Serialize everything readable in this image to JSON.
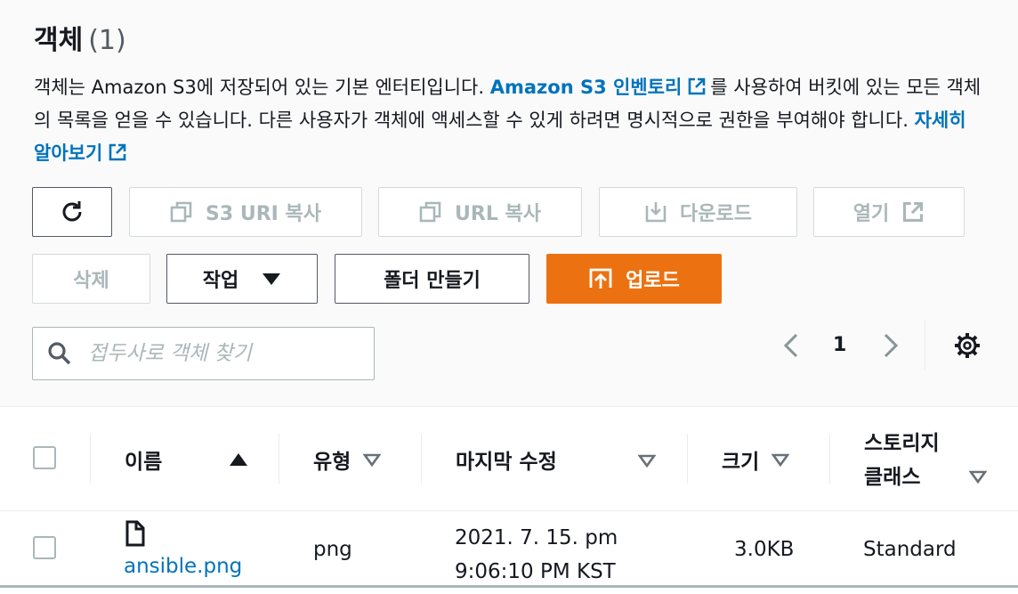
{
  "header": {
    "title": "객체",
    "count": "(1)"
  },
  "description": {
    "part1": "객체는 Amazon S3에 저장되어 있는 기본 엔터티입니다.",
    "link1": "Amazon S3 인벤토리",
    "part2": "를 사용하여 버킷에 있는 모든 객체의 목록을 얻을 수 있습니다. 다른 사용자가 객체에 액세스할 수 있게 하려면 명시적으로 권한을 부여해야 합니다.",
    "link2": "자세히 알아보기"
  },
  "toolbar": {
    "copy_uri": "S3 URI 복사",
    "copy_url": "URL 복사",
    "download": "다운로드",
    "open": "열기",
    "delete": "삭제",
    "actions": "작업",
    "create_folder": "폴더 만들기",
    "upload": "업로드"
  },
  "search": {
    "placeholder": "접두사로 객체 찾기"
  },
  "pagination": {
    "page": "1"
  },
  "table": {
    "columns": {
      "name": "이름",
      "type": "유형",
      "modified": "마지막 수정",
      "size": "크기",
      "storage_line1": "스토리지",
      "storage_line2": "클래스"
    },
    "rows": [
      {
        "name": "ansible.png",
        "type": "png",
        "modified_line1": "2021. 7. 15. pm",
        "modified_line2": "9:06:10 PM KST",
        "size": "3.0KB",
        "storage_class": "Standard"
      }
    ]
  },
  "colors": {
    "link": "#0073bb",
    "primary": "#ec7211",
    "disabled": "#aab7b8"
  }
}
